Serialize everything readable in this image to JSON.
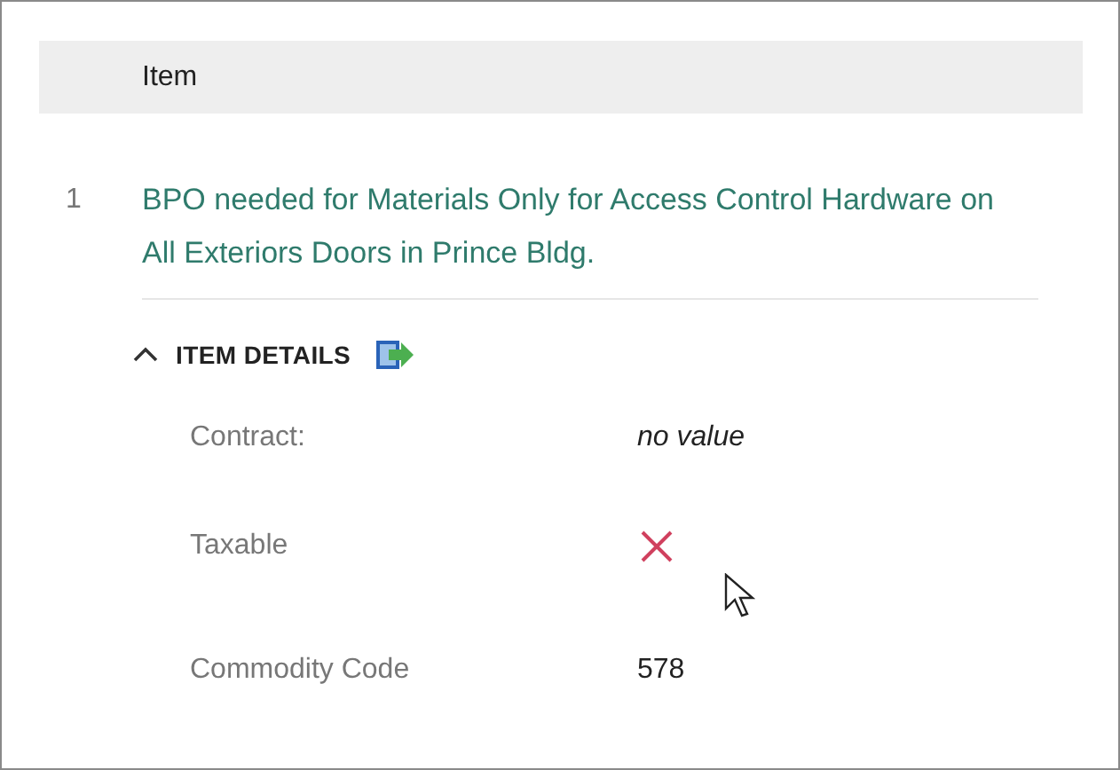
{
  "table": {
    "columns": [
      "Item"
    ],
    "rows": [
      {
        "number": "1",
        "title": "BPO needed for Materials Only for Access Control Hardware on All Exteriors Doors in Prince Bldg.",
        "details": {
          "heading": "ITEM DETAILS",
          "expanded": true,
          "fields": [
            {
              "kind": "empty",
              "label": "Contract:",
              "value": "no value"
            },
            {
              "kind": "boolean",
              "label": "Taxable",
              "checked": false
            },
            {
              "kind": "text",
              "label": "Commodity Code",
              "value": "578"
            }
          ]
        }
      }
    ]
  }
}
